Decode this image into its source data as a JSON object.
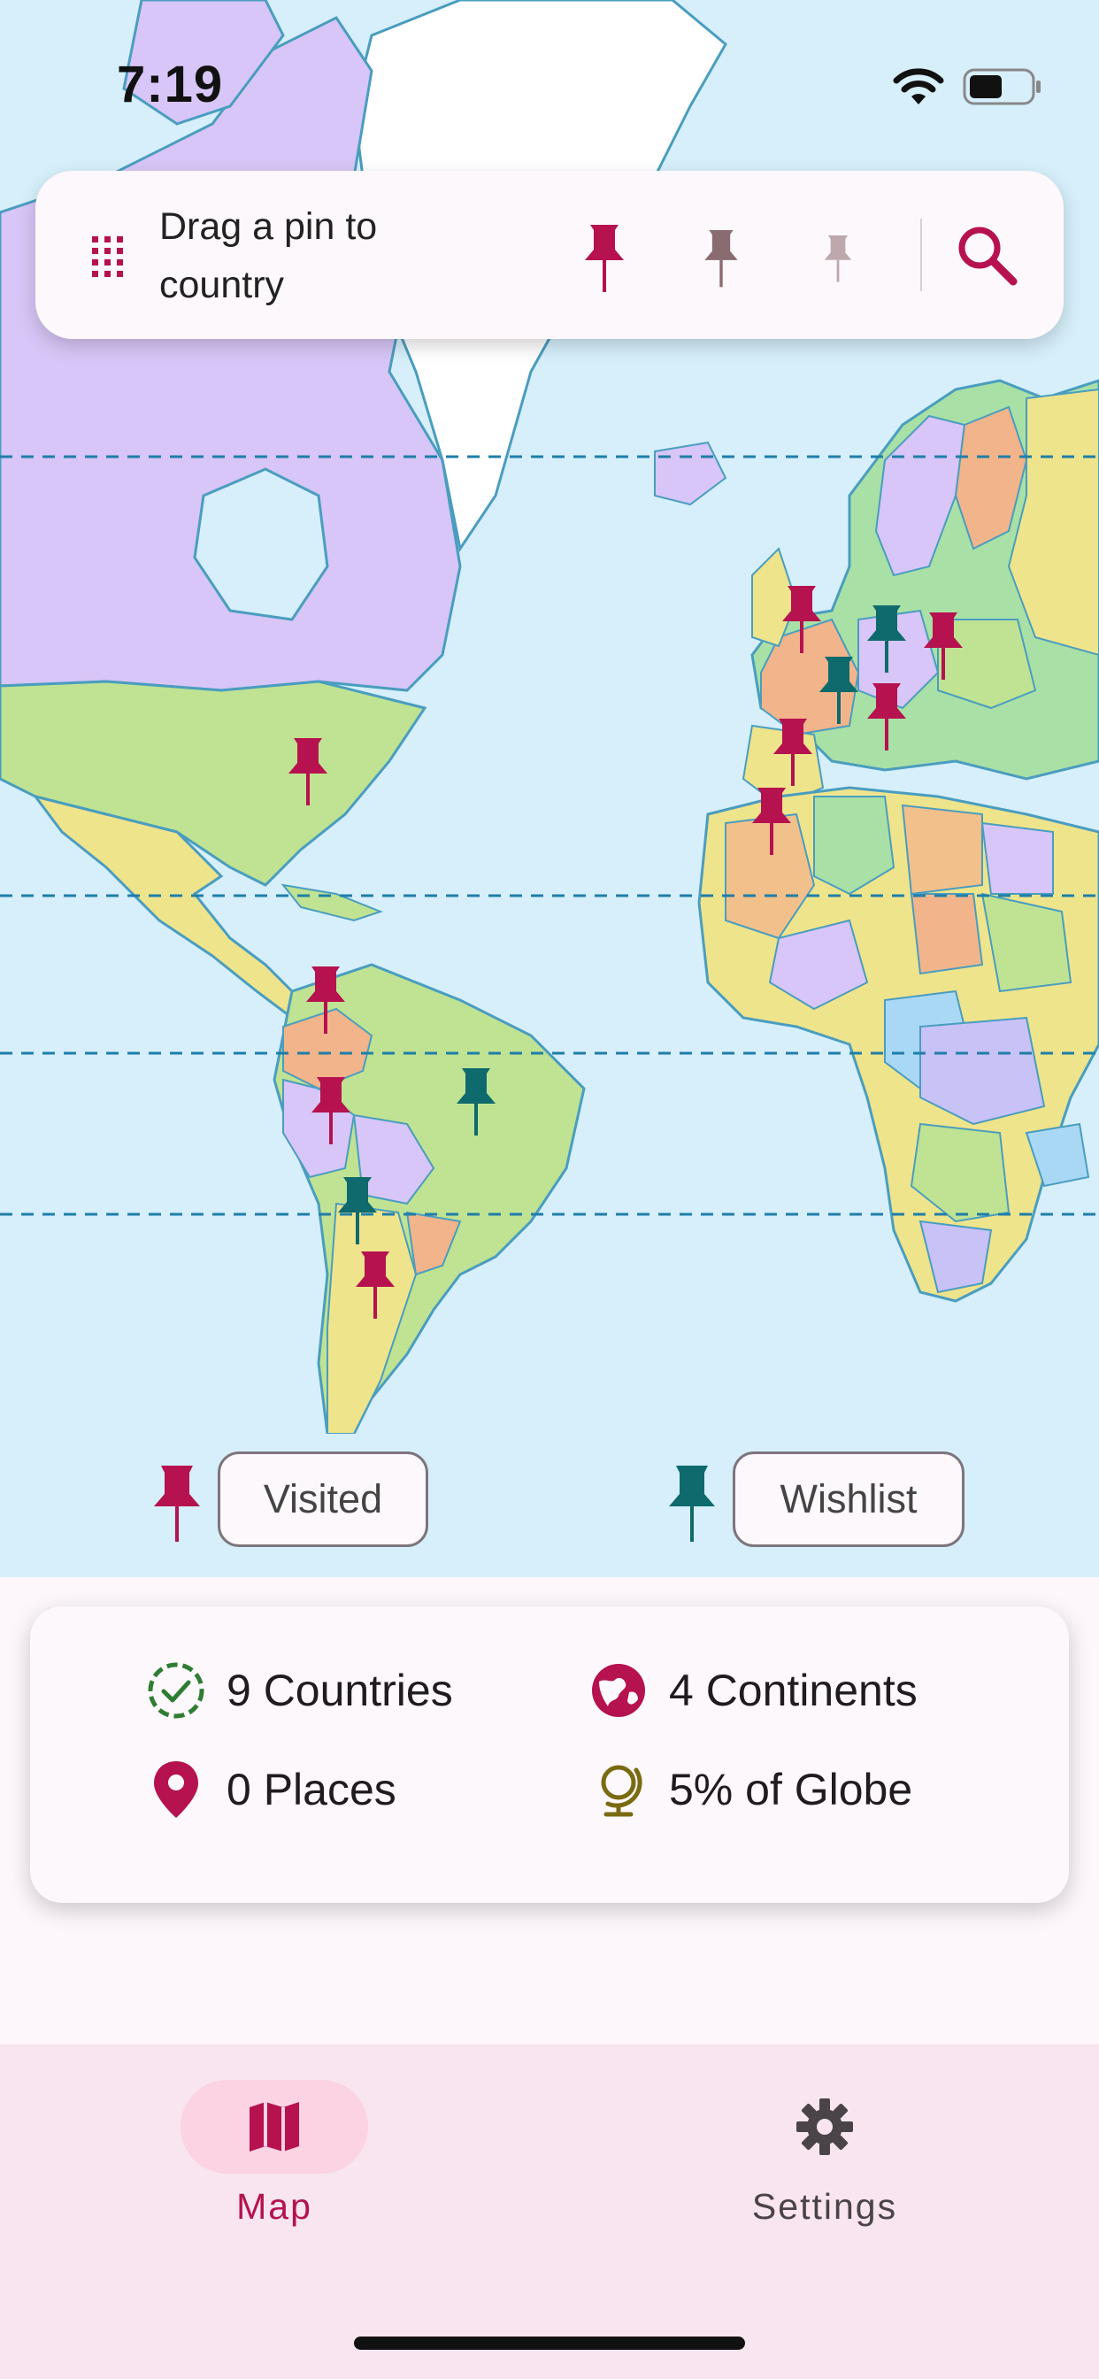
{
  "status": {
    "time": "7:19"
  },
  "toolbar": {
    "drag_hint": "Drag a pin to country",
    "pins": [
      {
        "name": "visited",
        "color": "#b5124f"
      },
      {
        "name": "medium",
        "color": "#8a6b70"
      },
      {
        "name": "light",
        "color": "#bda8ac"
      }
    ]
  },
  "colors": {
    "visited": "#b5124f",
    "wishlist": "#0e6a6c",
    "ocean": "#d6effb",
    "accent": "#b5124f",
    "success": "#2e7d32",
    "globe": "#7a6a10"
  },
  "legend": {
    "visited_label": "Visited",
    "wishlist_label": "Wishlist"
  },
  "stats": {
    "countries": "9 Countries",
    "continents": "4 Continents",
    "places": "0 Places",
    "globe": "5% of Globe"
  },
  "nav": {
    "map_label": "Map",
    "settings_label": "Settings"
  }
}
